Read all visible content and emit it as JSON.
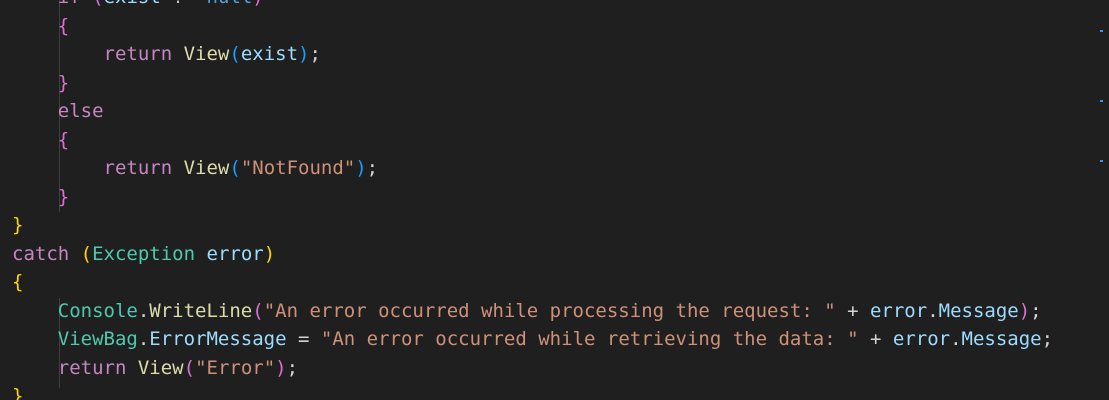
{
  "editor": {
    "theme": "dark",
    "background": "#1f1f1f",
    "colors": {
      "control_keyword": "#c586c0",
      "function": "#dcdcaa",
      "variable": "#9cdcfe",
      "type": "#4ec9b0",
      "string": "#ce9178",
      "bracket_level1": "#ffd700",
      "bracket_level2": "#da70d6",
      "bracket_level3": "#179fff"
    }
  },
  "code": {
    "l0_if": "if",
    "l0_paren_open": "(",
    "l0_var": "exist",
    "l0_op": " != ",
    "l0_null": "null",
    "l0_paren_close": ")",
    "l1_brace": "{",
    "l2_return": "return",
    "l2_fn": "View",
    "l2_open": "(",
    "l2_arg": "exist",
    "l2_close": ")",
    "l2_semi": ";",
    "l3_brace": "}",
    "l4_else": "else",
    "l5_brace": "{",
    "l6_return": "return",
    "l6_fn": "View",
    "l6_open": "(",
    "l6_str": "\"NotFound\"",
    "l6_close": ")",
    "l6_semi": ";",
    "l7_brace": "}",
    "l8_brace": "}",
    "l9_catch": "catch",
    "l9_open": "(",
    "l9_type": "Exception",
    "l9_var": "error",
    "l9_close": ")",
    "l10_brace": "{",
    "l11_class": "Console",
    "l11_dot": ".",
    "l11_fn": "WriteLine",
    "l11_open": "(",
    "l11_str": "\"An error occurred while processing the request: \"",
    "l11_plus": " + ",
    "l11_var": "error",
    "l11_dot2": ".",
    "l11_prop": "Message",
    "l11_close": ")",
    "l11_semi": ";",
    "l12_var": "ViewBag",
    "l12_dot": ".",
    "l12_prop": "ErrorMessage",
    "l12_eq": " = ",
    "l12_str": "\"An error occurred while retrieving the data: \"",
    "l12_plus": " + ",
    "l12_var2": "error",
    "l12_dot2": ".",
    "l12_prop2": "Message",
    "l12_semi": ";",
    "l13_return": "return",
    "l13_fn": "View",
    "l13_open": "(",
    "l13_str": "\"Error\"",
    "l13_close": ")",
    "l13_semi": ";",
    "l14_brace": "}"
  }
}
